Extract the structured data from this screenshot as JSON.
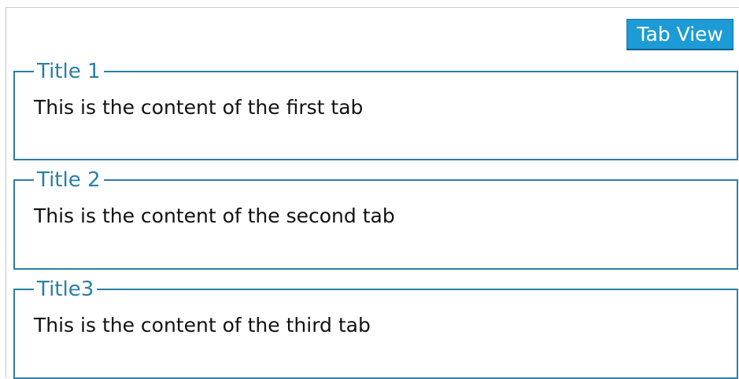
{
  "toolbar": {
    "tab_view_label": "Tab View"
  },
  "panels": [
    {
      "title": "Title 1",
      "content": "This is the content of the first tab"
    },
    {
      "title": "Title 2",
      "content": "This is the content of the second tab"
    },
    {
      "title": "Title3",
      "content": "This is the content of the third tab"
    }
  ],
  "colors": {
    "accent": "#2a7fa6",
    "button_bg": "#1c9bd6"
  }
}
